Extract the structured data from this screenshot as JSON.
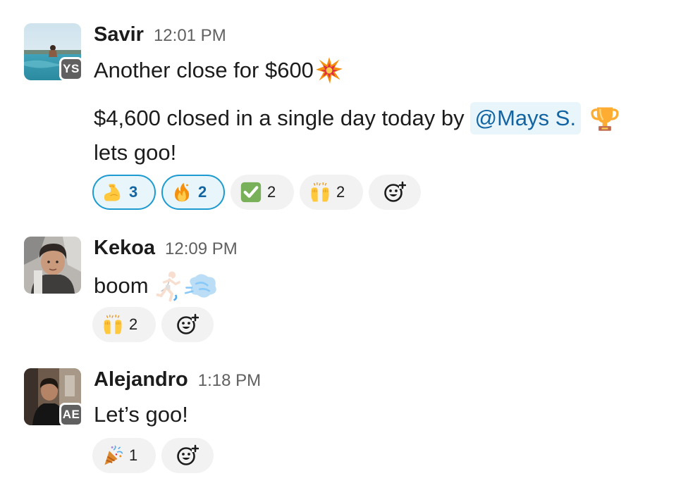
{
  "messages": [
    {
      "sender": "Savir",
      "time": "12:01 PM",
      "initials": "YS",
      "avatar_icon": "beach-pool-photo",
      "lines": [
        {
          "text": "Another close for $600",
          "emoji": "collision"
        },
        {
          "text": "$4,600 closed in a single day today by",
          "mention": "@Mays S.",
          "emoji": "trophy"
        },
        {
          "text": "lets goo!"
        }
      ],
      "reactions": [
        {
          "emoji": "flexed-biceps",
          "count": "3",
          "active": true
        },
        {
          "emoji": "fire",
          "count": "2",
          "active": true
        },
        {
          "emoji": "check-mark-button",
          "count": "2",
          "active": false
        },
        {
          "emoji": "raising-hands",
          "count": "2",
          "active": false
        }
      ]
    },
    {
      "sender": "Kekoa",
      "time": "12:09 PM",
      "avatar_icon": "selfie-photo",
      "lines": [
        {
          "text": "boom",
          "emoji": "person-running-dash"
        }
      ],
      "reactions": [
        {
          "emoji": "raising-hands",
          "count": "2",
          "active": false
        }
      ]
    },
    {
      "sender": "Alejandro",
      "time": "1:18 PM",
      "initials": "AE",
      "avatar_icon": "portrait-photo",
      "lines": [
        {
          "text": "Let’s goo!"
        }
      ],
      "reactions": [
        {
          "emoji": "party-popper",
          "count": "1",
          "active": false
        }
      ]
    }
  ],
  "add_reaction_icon": "add-reaction-smiley-icon",
  "colors": {
    "mention_bg": "#e8f5fa",
    "mention_text": "#1264a3",
    "active_reaction_border": "#1d9bd1",
    "reaction_bg": "#f2f2f2",
    "timestamp": "#616061",
    "initials_badge": "#616061"
  }
}
